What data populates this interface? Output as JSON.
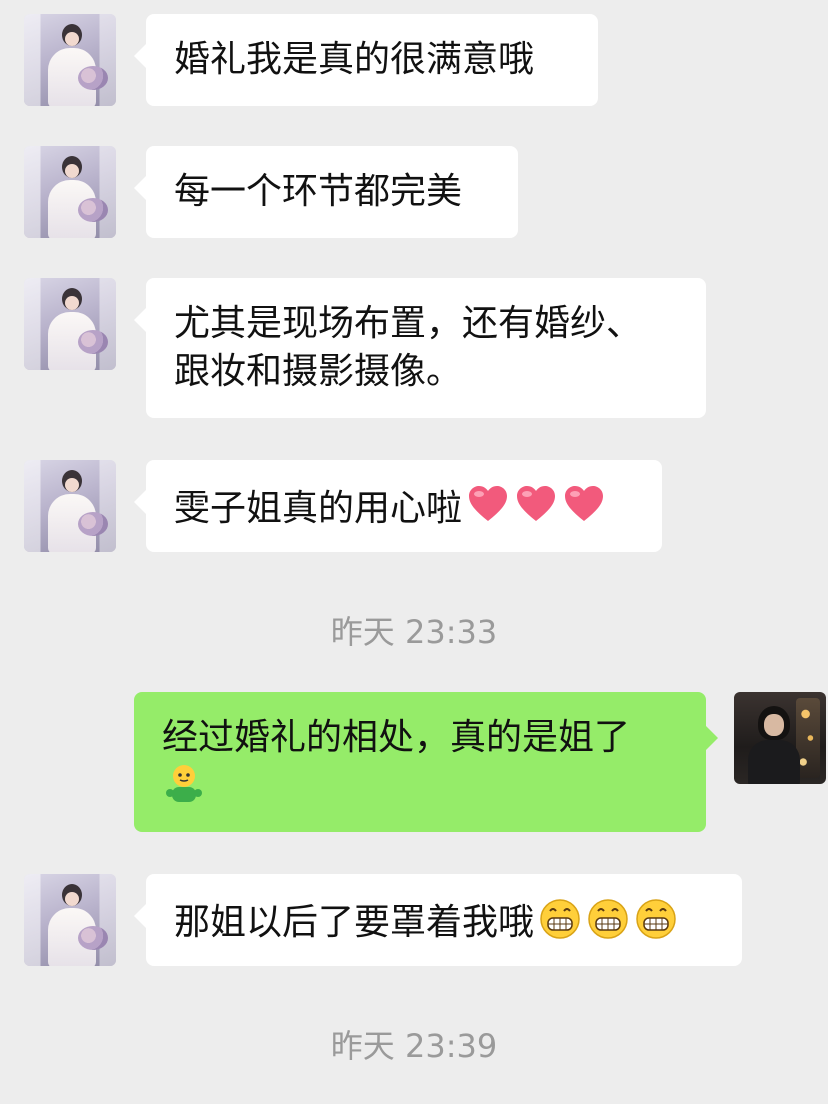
{
  "messages": [
    {
      "side": "left",
      "lines": [
        "婚礼我是真的很满意哦"
      ]
    },
    {
      "side": "left",
      "lines": [
        "每一个环节都完美"
      ]
    },
    {
      "side": "left",
      "lines": [
        "尤其是现场布置，还有婚纱、",
        "跟妆和摄影摄像。"
      ]
    },
    {
      "side": "left",
      "lines": [
        "雯子姐真的用心啦"
      ],
      "emojis": [
        "heart-icon",
        "heart-icon",
        "heart-icon"
      ]
    },
    {
      "side": "right",
      "lines": [
        "经过婚礼的相处，真的是姐了"
      ],
      "emojis": [
        "doll-emoji-icon"
      ]
    },
    {
      "side": "left",
      "lines": [
        "那姐以后了要罩着我哦"
      ],
      "emojis": [
        "grin-emoji-icon",
        "grin-emoji-icon",
        "grin-emoji-icon"
      ]
    }
  ],
  "timestamps": [
    "昨天 23:33",
    "昨天 23:39"
  ],
  "colors": {
    "background": "#ededed",
    "incoming_bubble": "#ffffff",
    "outgoing_bubble": "#95ec69",
    "timestamp": "#9a9a9a"
  }
}
